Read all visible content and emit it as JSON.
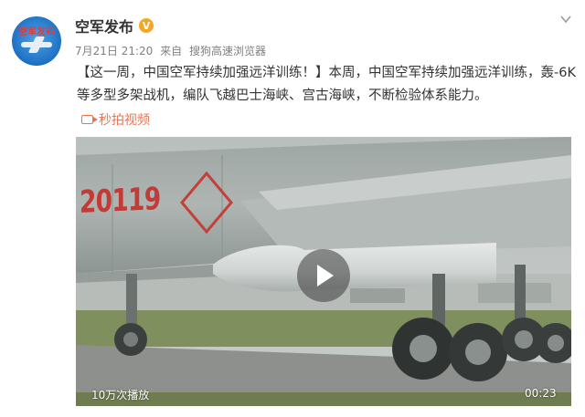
{
  "user": {
    "name": "空军发布",
    "avatar_text": "空军发布",
    "verified_mark": "V"
  },
  "meta": {
    "date": "7月21日 21:20",
    "from_label": "来自",
    "source": "搜狗高速浏览器"
  },
  "post": {
    "text": "【这一周，中国空军持续加强远洋训练！】本周，中国空军持续加强远洋训练，轰-6K等多型多架战机，编队飞越巴士海峡、宫古海峡，不断检验体系能力。"
  },
  "video_link": {
    "label": "秒拍视频"
  },
  "video": {
    "views": "10万次播放",
    "duration": "00:23",
    "tail_number": "20119"
  },
  "colors": {
    "link_orange": "#eb7350",
    "verified": "#f5a623",
    "meta_gray": "#808080"
  }
}
